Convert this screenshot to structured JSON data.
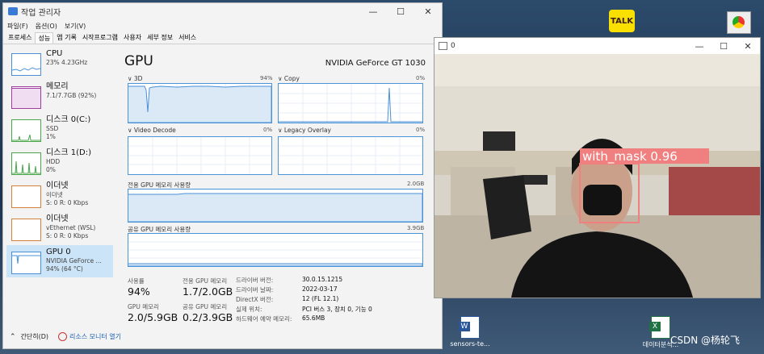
{
  "desktop": {
    "icons": [
      {
        "name": "kakaotalk",
        "label": "TALK"
      },
      {
        "name": "chrome",
        "label": ""
      },
      {
        "name": "word-file",
        "label": "sensors-te..."
      },
      {
        "name": "excel-file",
        "label": "데이터분석..."
      }
    ],
    "watermark": "CSDN @杨轮飞"
  },
  "task_manager": {
    "title": "작업 관리자",
    "menu": [
      "파일(F)",
      "옵션(O)",
      "보기(V)"
    ],
    "tabs": [
      "프로세스",
      "성능",
      "앱 기록",
      "시작프로그램",
      "사용자",
      "세부 정보",
      "서비스"
    ],
    "active_tab": "성능",
    "sidebar": [
      {
        "name": "CPU",
        "d1": "23% 4.23GHz",
        "d2": "",
        "d3": "",
        "color": "#4a90d9"
      },
      {
        "name": "메모리",
        "d1": "7.1/7.7GB (92%)",
        "d2": "",
        "d3": "",
        "color": "#a03ea0"
      },
      {
        "name": "디스크 0(C:)",
        "d1": "SSD",
        "d2": "1%",
        "d3": "",
        "color": "#4ca64c"
      },
      {
        "name": "디스크 1(D:)",
        "d1": "HDD",
        "d2": "0%",
        "d3": "",
        "color": "#4ca64c"
      },
      {
        "name": "이더넷",
        "d1": "이더넷",
        "d2": "S: 0 R: 0 Kbps",
        "d3": "",
        "color": "#d0813a"
      },
      {
        "name": "이더넷",
        "d1": "vEthernet (WSL)",
        "d2": "S: 0 R: 0 Kbps",
        "d3": "",
        "color": "#d0813a"
      },
      {
        "name": "GPU 0",
        "d1": "NVIDIA GeForce ...",
        "d2": "94% (64 °C)",
        "d3": "",
        "color": "#4a90d9"
      }
    ],
    "gpu": {
      "title": "GPU",
      "model": "NVIDIA GeForce GT 1030",
      "graphs": [
        {
          "label": "3D",
          "value": "94%"
        },
        {
          "label": "Copy",
          "value": "0%"
        },
        {
          "label": "Video Decode",
          "value": "0%"
        },
        {
          "label": "Legacy Overlay",
          "value": "0%"
        }
      ],
      "dedicated_label": "전용 GPU 메모리 사용량",
      "dedicated_max": "2.0GB",
      "shared_label": "공유 GPU 메모리 사용량",
      "shared_max": "3.9GB",
      "stats": {
        "usage_label": "사용률",
        "usage_value": "94%",
        "ded_label": "전용 GPU 메모리",
        "ded_value": "1.7/2.0GB",
        "gpu_mem_label": "GPU 메모리",
        "gpu_mem_value": "2.0/5.9GB",
        "shared_label": "공유 GPU 메모리",
        "shared_value": "0.2/3.9GB"
      },
      "info": [
        {
          "label": "드라이버 버전:",
          "value": "30.0.15.1215"
        },
        {
          "label": "드라이버 날짜:",
          "value": "2022-03-17"
        },
        {
          "label": "DirectX 버전:",
          "value": "12 (FL 12.1)"
        },
        {
          "label": "실제 위치:",
          "value": "PCI 버스 3, 장치 0, 기능 0"
        },
        {
          "label": "하드웨어 예약 메모리:",
          "value": "65.6MB"
        }
      ]
    },
    "footer": {
      "less": "간단히(D)",
      "monitor": "리소스 모니터 열기"
    }
  },
  "camera": {
    "title": "0",
    "detection_label": "with_mask 0.96"
  }
}
